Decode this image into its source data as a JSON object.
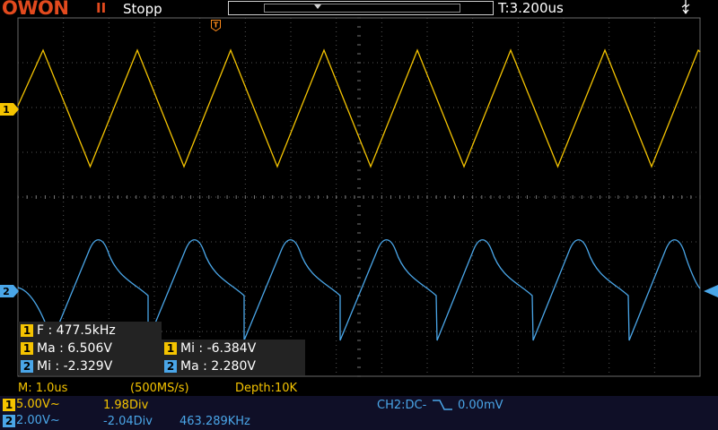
{
  "header": {
    "logo": "OWON",
    "run_icon": "II",
    "status": "Stopp",
    "timebase": "T:3.200us"
  },
  "markers": {
    "trigger": "T",
    "ch1": "1",
    "ch2": "2"
  },
  "measurements": {
    "ch1_freq": {
      "ch": "1",
      "text": "F : 477.5kHz"
    },
    "ch1_max": {
      "ch": "1",
      "text": "Ma : 6.506V"
    },
    "ch1_min": {
      "ch": "1",
      "text": "Mi : -6.384V"
    },
    "ch2_min": {
      "ch": "2",
      "text": "Mi : -2.329V"
    },
    "ch2_max": {
      "ch": "2",
      "text": "Ma : 2.280V"
    }
  },
  "statusline": {
    "main_timebase": "M: 1.0us",
    "sample_rate": "(500MS/s)",
    "depth": "Depth:10K"
  },
  "channels": {
    "ch1": {
      "label": "1",
      "volts": "5.00V~",
      "offset": "1.98Div"
    },
    "ch2": {
      "label": "2",
      "volts": "2.00V~",
      "offset": "-2.04Div",
      "freq": "463.289KHz"
    }
  },
  "trigger": {
    "source": "CH2:DC-",
    "level": "0.00mV"
  },
  "colors": {
    "ch1": "#f5c400",
    "ch2": "#4aa6e8",
    "logo": "#e24a1e",
    "grid": "#5a5a5a"
  },
  "icons": [
    "pause-icon",
    "usb-icon",
    "trigger-marker-icon",
    "falling-edge-icon"
  ]
}
